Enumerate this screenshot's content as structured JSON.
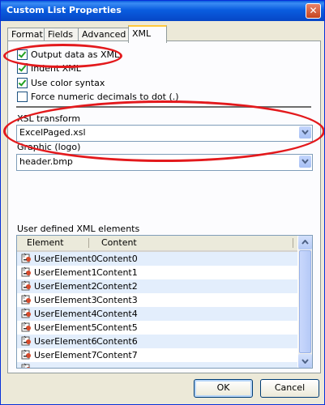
{
  "window": {
    "title": "Custom List Properties",
    "close_glyph": "✕"
  },
  "tabs": [
    {
      "label": "Format",
      "active": false
    },
    {
      "label": "Fields",
      "active": false
    },
    {
      "label": "Advanced",
      "active": false
    },
    {
      "label": "XML",
      "active": true
    }
  ],
  "options": [
    {
      "label": "Output data as XML",
      "checked": true
    },
    {
      "label": "Indent XML",
      "checked": true
    },
    {
      "label": "Use color syntax",
      "checked": true
    },
    {
      "label": "Force numeric decimals to dot (.)",
      "checked": false
    }
  ],
  "xsl": {
    "label": "XSL transform",
    "value": "ExcelPaged.xsl"
  },
  "graphic": {
    "label": "Graphic (logo)",
    "value": "header.bmp"
  },
  "user_elements": {
    "label": "User defined XML elements",
    "columns": [
      "Element",
      "Content"
    ],
    "rows": [
      [
        "UserElement0",
        "Content0"
      ],
      [
        "UserElement1",
        "Content1"
      ],
      [
        "UserElement2",
        "Content2"
      ],
      [
        "UserElement3",
        "Content3"
      ],
      [
        "UserElement4",
        "Content4"
      ],
      [
        "UserElement5",
        "Content5"
      ],
      [
        "UserElement6",
        "Content6"
      ],
      [
        "UserElement7",
        "Content7"
      ]
    ]
  },
  "buttons": {
    "ok": "OK",
    "cancel": "Cancel"
  },
  "colors": {
    "title_bar": "#0a5ddf",
    "highlight": "#e3191c",
    "row_alt": "#e3eefc"
  },
  "icons": {
    "row_icon": "key-icon",
    "combo_arrow": "chevron-down-icon"
  }
}
